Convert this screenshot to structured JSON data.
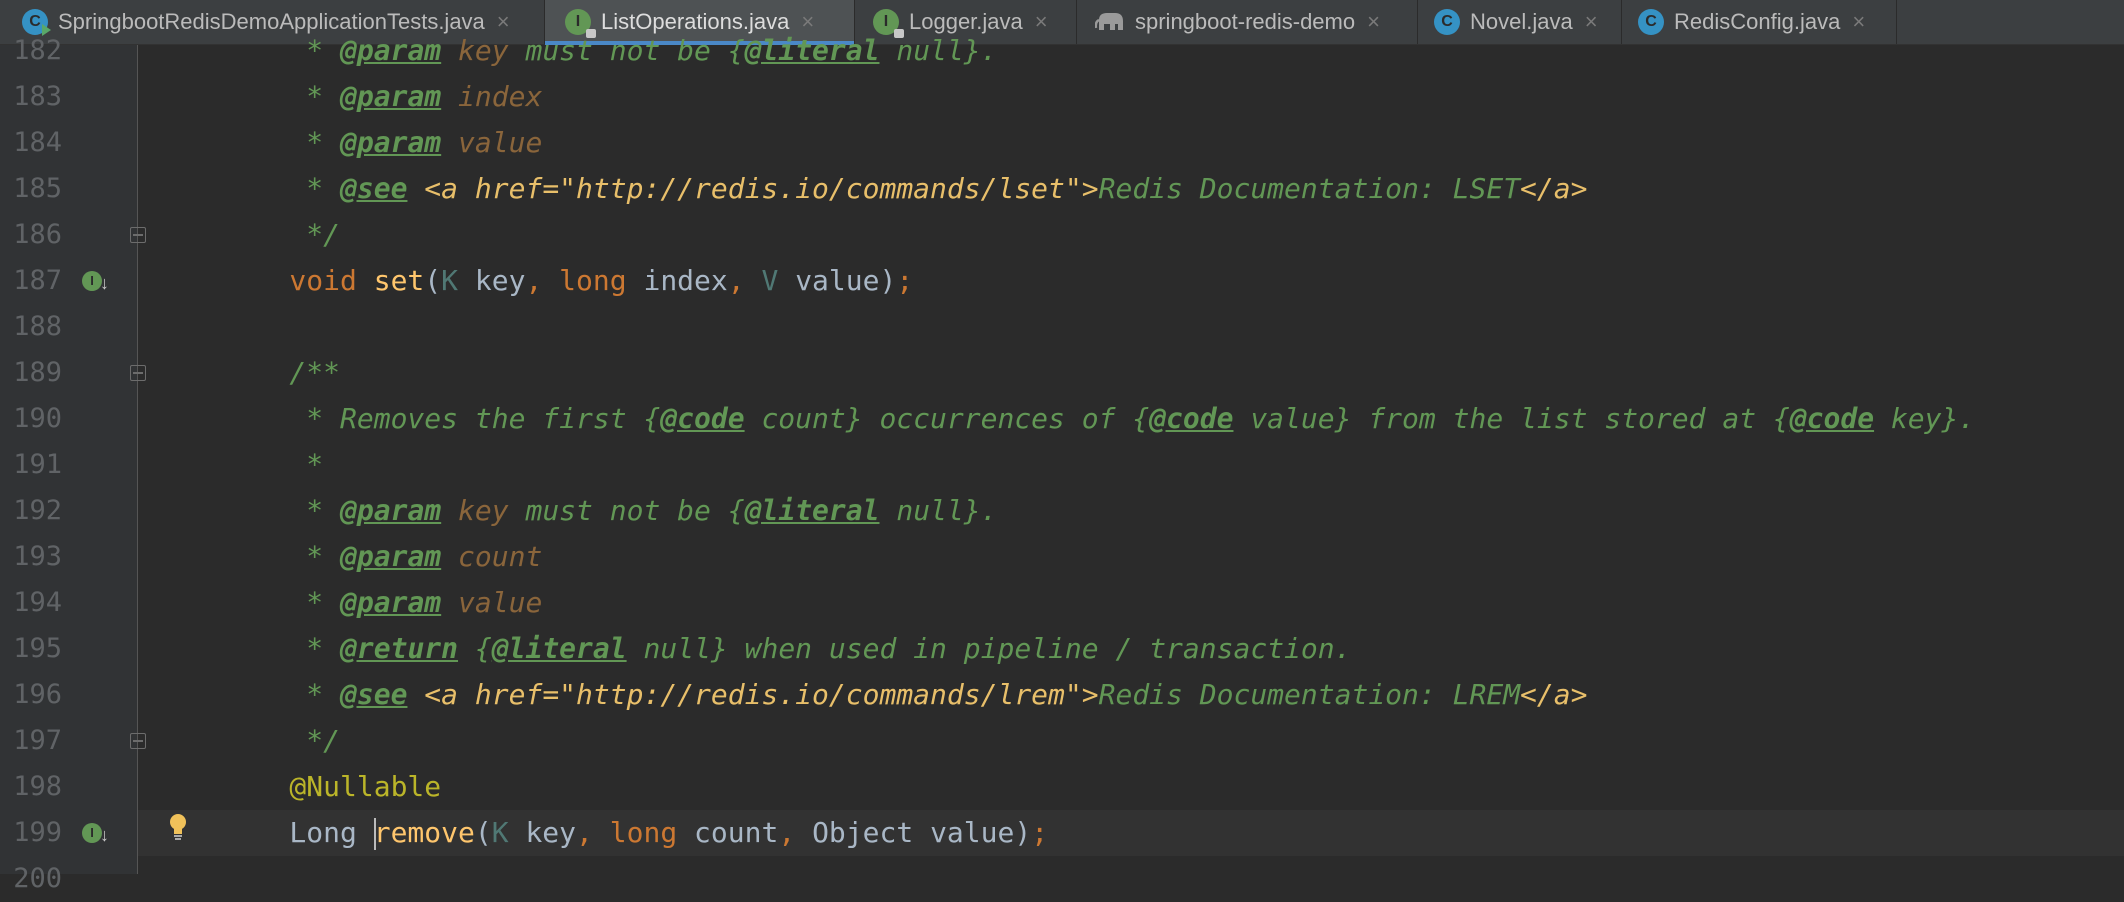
{
  "tabs": [
    {
      "label": "SpringbootRedisDemoApplicationTests.java",
      "icon": "class-icon",
      "close": "×"
    },
    {
      "label": "ListOperations.java",
      "icon": "interface-icon",
      "close": "×"
    },
    {
      "label": "Logger.java",
      "icon": "interface-icon",
      "close": "×"
    },
    {
      "label": "springboot-redis-demo",
      "icon": "maven-elephant-icon",
      "close": "×"
    },
    {
      "label": "Novel.java",
      "icon": "class-icon",
      "close": "×"
    },
    {
      "label": "RedisConfig.java",
      "icon": "class-icon",
      "close": "×"
    }
  ],
  "icon_letters": {
    "class": "C",
    "interface": "I"
  },
  "line_numbers": [
    "182",
    "183",
    "184",
    "185",
    "186",
    "187",
    "188",
    "189",
    "190",
    "191",
    "192",
    "193",
    "194",
    "195",
    "196",
    "197",
    "198",
    "199",
    "200"
  ],
  "code": {
    "l182": {
      "star": "     * ",
      "tag": "@param",
      "pname": " key",
      "rest": " must not be {",
      "tag2": "@literal",
      "rest2": " null}."
    },
    "l183": {
      "star": "     * ",
      "tag": "@param",
      "pname": " index"
    },
    "l184": {
      "star": "     * ",
      "tag": "@param",
      "pname": " value"
    },
    "l185": {
      "star": "     * ",
      "tag": "@see",
      "html1": " <a href=\"http://redis.io/commands/lset\">",
      "text": "Redis Documentation: LSET",
      "html2": "</a>"
    },
    "l186": {
      "text": "     */"
    },
    "l187": {
      "kw1": "    void ",
      "fn": "set",
      "p1": "(",
      "t1": "K",
      "p2": " key",
      "c1": ", ",
      "kw2": "long",
      "p3": " index",
      "c2": ", ",
      "t2": "V",
      "p4": " value)",
      "c3": ";"
    },
    "l189": {
      "text": "    /**"
    },
    "l190": {
      "a": "     * Removes the first {",
      "tag1": "@code",
      "b": " count} occurrences of {",
      "tag2": "@code",
      "c": " value} from the list stored at {",
      "tag3": "@code",
      "d": " key}."
    },
    "l191": {
      "text": "     *"
    },
    "l192": {
      "star": "     * ",
      "tag": "@param",
      "pname": " key",
      "rest": " must not be {",
      "tag2": "@literal",
      "rest2": " null}."
    },
    "l193": {
      "star": "     * ",
      "tag": "@param",
      "pname": " count"
    },
    "l194": {
      "star": "     * ",
      "tag": "@param",
      "pname": " value"
    },
    "l195": {
      "star": "     * ",
      "tag": "@return",
      "a": " {",
      "tag2": "@literal",
      "b": " null} when used in pipeline / transaction."
    },
    "l196": {
      "star": "     * ",
      "tag": "@see",
      "html1": " <a href=\"http://redis.io/commands/lrem\">",
      "text": "Redis Documentation: LREM",
      "html2": "</a>"
    },
    "l197": {
      "text": "     */"
    },
    "l198": {
      "ann": "    @Nullable"
    },
    "l199": {
      "p0": "    Long ",
      "fn": "remove",
      "p1": "(",
      "t1": "K",
      "p2": " key",
      "c1": ", ",
      "kw": "long",
      "p3": " count",
      "c2": ", ",
      "p4": "Object value)",
      "c3": ";"
    }
  }
}
